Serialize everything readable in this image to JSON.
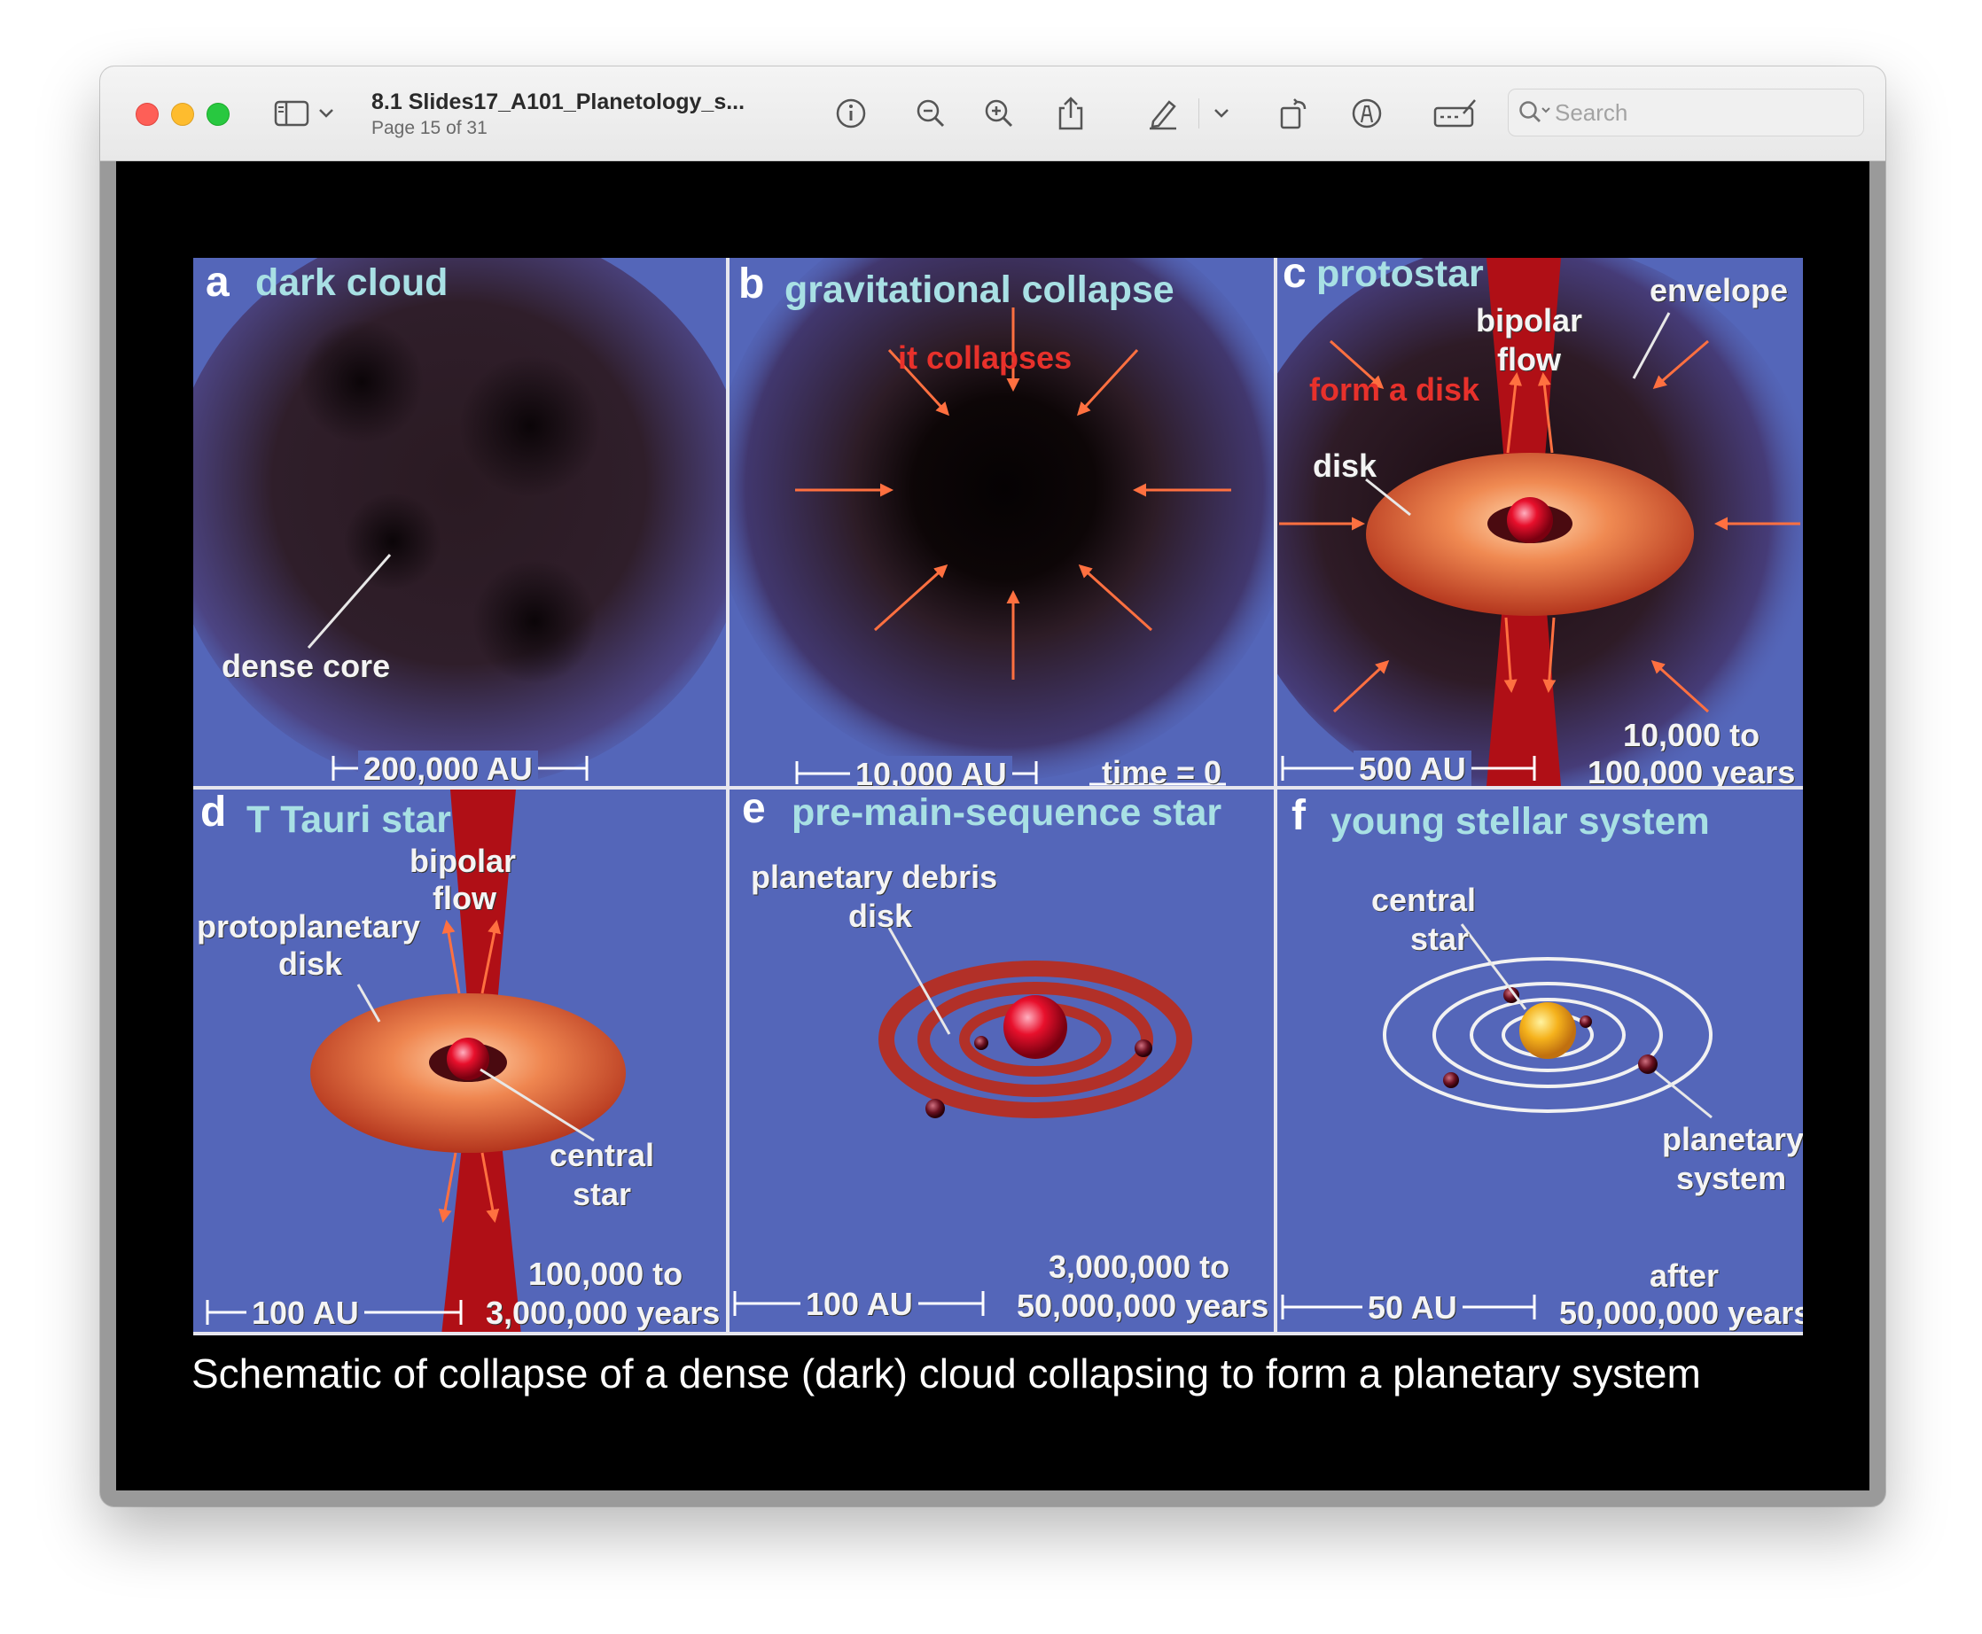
{
  "window": {
    "title": "8.1 Slides17_A101_Planetology_s...",
    "subtitle": "Page 15 of 31"
  },
  "toolbar": {
    "icons": [
      "sidebar-icon",
      "chevron-down-icon",
      "info-icon",
      "zoom-out-icon",
      "zoom-in-icon",
      "share-icon",
      "highlight-pen-icon",
      "chevron-down-icon",
      "rotate-icon",
      "markup-icon",
      "form-fill-icon"
    ],
    "search_placeholder": "Search"
  },
  "figure": {
    "panel_a": {
      "letter": "a",
      "title": "dark cloud",
      "labels": [
        "dense core"
      ],
      "scale": "200,000 AU"
    },
    "panel_b": {
      "letter": "b",
      "title": "gravitational collapse",
      "annotation": "it collapses",
      "scale": "10,000 AU",
      "time": "time = 0"
    },
    "panel_c": {
      "letter": "c",
      "title": "protostar",
      "annotation": "form a disk",
      "labels": [
        "bipolar",
        "flow",
        "envelope",
        "disk"
      ],
      "scale": "500 AU",
      "duration": [
        "10,000 to",
        "100,000 years"
      ]
    },
    "panel_d": {
      "letter": "d",
      "title": "T Tauri star",
      "labels": [
        "bipolar",
        "flow",
        "protoplanetary",
        "disk",
        "central",
        "star"
      ],
      "scale": "100 AU",
      "duration": [
        "100,000 to",
        "3,000,000 years"
      ]
    },
    "panel_e": {
      "letter": "e",
      "title": "pre-main-sequence star",
      "labels": [
        "planetary debris",
        "disk"
      ],
      "scale": "100 AU",
      "duration": [
        "3,000,000 to",
        "50,000,000 years"
      ]
    },
    "panel_f": {
      "letter": "f",
      "title": "young stellar system",
      "labels": [
        "central",
        "star",
        "planetary",
        "system"
      ],
      "scale": "50 AU",
      "duration": [
        "after",
        "50,000,000 years"
      ]
    }
  },
  "caption": "Schematic of collapse of a dense (dark) cloud collapsing to form a planetary system",
  "colors": {
    "annotation_red": "#e8312b",
    "panel_title": "#a8e0e4",
    "background_blue": "#5466b9"
  }
}
